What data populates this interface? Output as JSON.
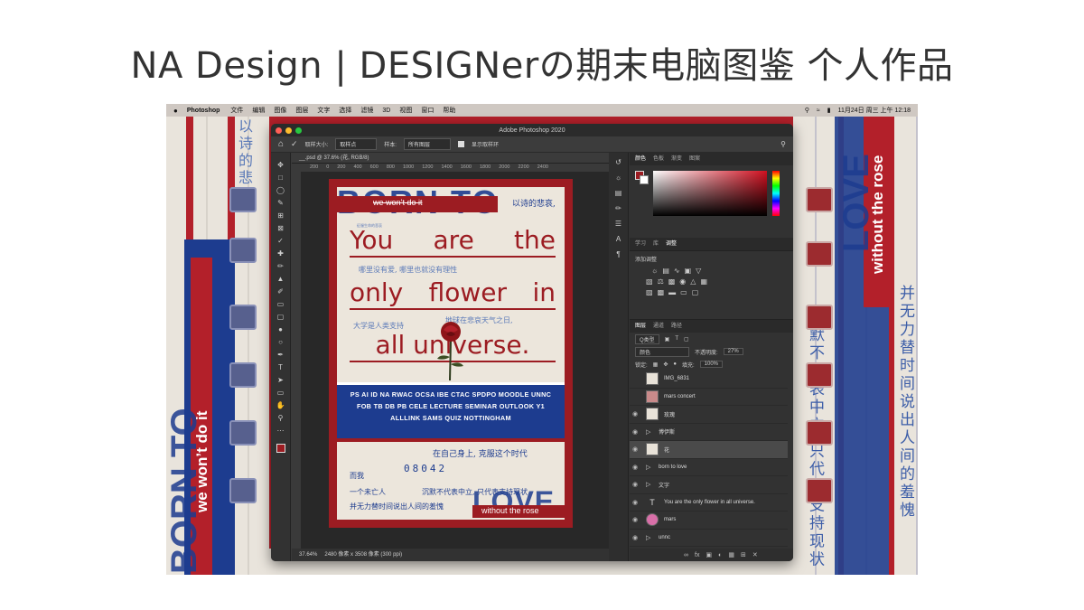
{
  "slide": {
    "title": "NA Design | DESIGNerの期末电脑图鉴 个人作品"
  },
  "menubar": {
    "app": "Photoshop",
    "items": [
      "文件",
      "编辑",
      "图像",
      "图层",
      "文字",
      "选择",
      "滤镜",
      "3D",
      "视图",
      "窗口",
      "帮助"
    ],
    "clock": "11月24日 周三 上午 12:18"
  },
  "ps": {
    "window_title": "Adobe Photoshop 2020",
    "options": {
      "sample_size_label": "取样大小:",
      "sample_size_value": "取样点",
      "sample_label": "样本:",
      "sample_value": "所有图层",
      "show_ring_label": "显示取样环"
    },
    "doc_tab": "__.psd @ 37.6% (花, RGB/8)",
    "ruler": [
      "200",
      "0",
      "200",
      "400",
      "600",
      "800",
      "1000",
      "1200",
      "1400",
      "1600",
      "1800",
      "2000",
      "2200",
      "2400"
    ],
    "status": {
      "zoom": "37.64%",
      "info": "2480 像素 x 3508 像素 (300 ppi)"
    },
    "color_tabs": [
      "颜色",
      "色板",
      "渐变",
      "图案"
    ],
    "adj_tabs": [
      "学习",
      "库",
      "调整"
    ],
    "adj_title": "添加调整",
    "layers_tabs": [
      "图层",
      "通道",
      "路径"
    ],
    "layer_kind": "Q类型",
    "blend_mode": "颜色",
    "opacity_label": "不透明度:",
    "opacity_value": "27%",
    "lock_label": "锁定:",
    "fill_label": "填充:",
    "fill_value": "100%",
    "layers": [
      {
        "name": "IMG_6831",
        "kind": "image",
        "visible": false
      },
      {
        "name": "mars concert",
        "kind": "image",
        "visible": false
      },
      {
        "name": "玫瑰",
        "kind": "image",
        "visible": true
      },
      {
        "name": "博伊斯",
        "kind": "group",
        "visible": true
      },
      {
        "name": "花",
        "kind": "image",
        "visible": true,
        "selected": true
      },
      {
        "name": "born to love",
        "kind": "group",
        "visible": true
      },
      {
        "name": "文字",
        "kind": "group",
        "visible": true
      },
      {
        "name": "You are the only flower in all universe.",
        "kind": "text",
        "visible": true
      },
      {
        "name": "mars",
        "kind": "image",
        "visible": true
      },
      {
        "name": "unnc",
        "kind": "group",
        "visible": true
      }
    ]
  },
  "poster": {
    "born_to": "BORN TO",
    "we_wont": "we won’t do it",
    "chn_top": "以诗的悲哀,",
    "chn_sub": "征服生命的悲哀",
    "headline": [
      "You are the",
      "only flower in",
      "all universe."
    ],
    "chn_mid_1": "哪里没有爱, 哪里也就没有理性",
    "chn_mid_2": "地球在悲哀天气之日,",
    "chn_mid_3": "大学是人类支持",
    "band": "PS AI ID NA RWAC OCSA IBE CTAC SPDPO MOODLE UNNC FOB TB DB PB CELE LECTURE SEMINAR OUTLOOK Y1 ALLLINK SAMS QUIZ NOTTINGHAM",
    "chn_low_1": "在自己身上, 克服这个时代",
    "number": "08042",
    "chn_low_2": "沉默不代表中立, 只代表支持现状",
    "chn_low_3": "一个未亡人",
    "chn_low_4": "并无力替时间说出人间的羞愧",
    "chn_low_5": "而我",
    "love": "LOVE",
    "without_the_rose": "without the rose"
  },
  "background": {
    "left_vertical": "we won’t do it",
    "right_vertical": "without the rose",
    "left_big": "BORN TO",
    "right_big": "LOVE",
    "right_chn": "沉默不代表中立 只代表支持现状",
    "right_chn_2": "并无力替时间说出人间的羞愧",
    "left_chn": "以诗的悲哀"
  }
}
